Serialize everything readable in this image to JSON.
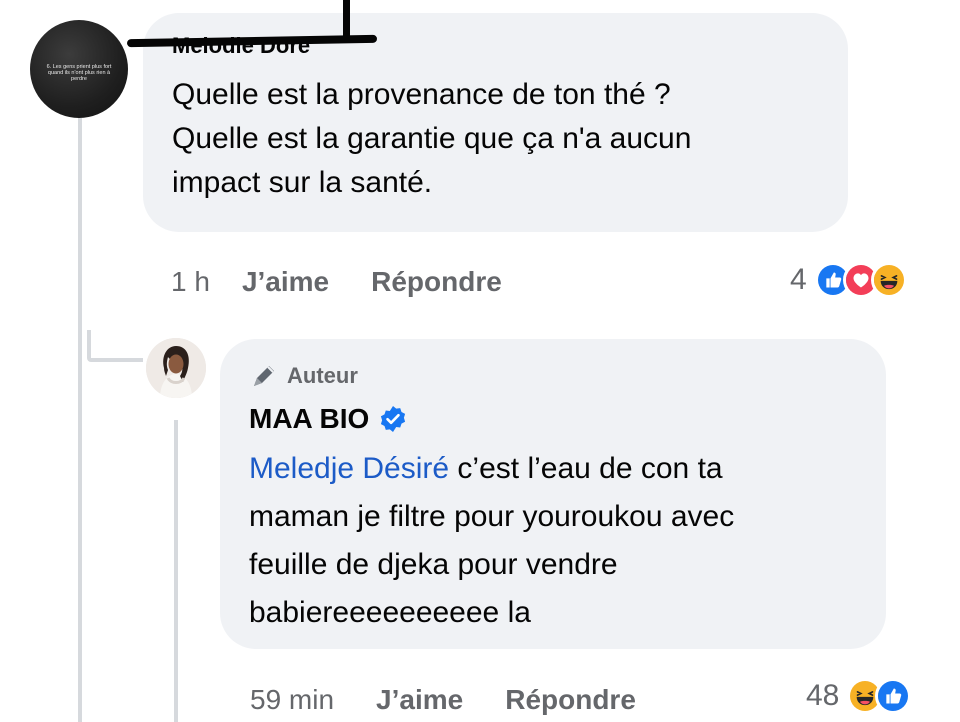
{
  "comment1": {
    "author": "Melodie Doré",
    "avatar_caption": "6. Les gens prient plus fort quand ils n'ont plus rien à perdre",
    "text_lines": [
      "Quelle est la provenance de ton thé ?",
      "Quelle est la garantie que ça n'a aucun",
      "impact sur la santé."
    ],
    "time": "1 h",
    "like_label": "J’aime",
    "reply_label": "Répondre",
    "reaction_count": "4",
    "reaction_icons": [
      "like-icon",
      "love-icon",
      "haha-icon"
    ]
  },
  "comment2": {
    "badge": "Auteur",
    "author": "MAA BIO",
    "verified_icon": "verified-badge-icon",
    "mention": "Meledje Désiré",
    "text_line1_rest": " c’est l’eau de con ta",
    "text_lines": [
      "maman je filtre pour youroukou avec",
      "feuille de djeka pour vendre",
      "babiereeeeeeeeee la"
    ],
    "time": "59 min",
    "like_label": "J’aime",
    "reply_label": "Répondre",
    "reaction_count": "48",
    "reaction_icons": [
      "haha-icon",
      "like-icon"
    ]
  },
  "colors": {
    "bubble": "#f0f2f5",
    "mention": "#1c5bc7",
    "secondary_text": "#65676b",
    "like": "#1877f2",
    "love": "#f33e58",
    "haha": "#f7b125"
  }
}
